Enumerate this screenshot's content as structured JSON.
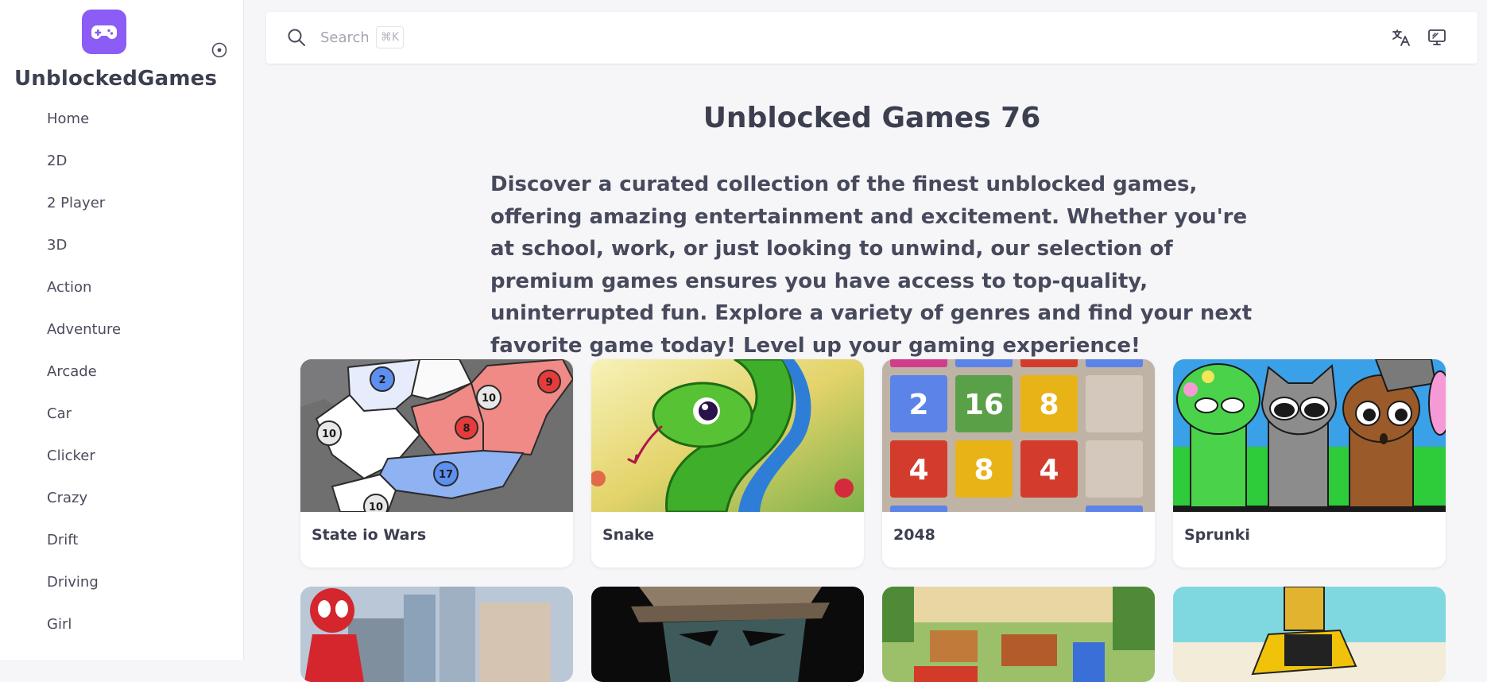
{
  "brand": {
    "name": "UnblockedGames",
    "logo_icon": "gamepad-icon",
    "accent": "#8b5cf6"
  },
  "sidebar": {
    "collapse_icon": "collapse-circle-icon",
    "items": [
      {
        "label": "Home"
      },
      {
        "label": "2D"
      },
      {
        "label": "2 Player"
      },
      {
        "label": "3D"
      },
      {
        "label": "Action"
      },
      {
        "label": "Adventure"
      },
      {
        "label": "Arcade"
      },
      {
        "label": "Car"
      },
      {
        "label": "Clicker"
      },
      {
        "label": "Crazy"
      },
      {
        "label": "Drift"
      },
      {
        "label": "Driving"
      },
      {
        "label": "Girl"
      }
    ]
  },
  "header": {
    "search": {
      "placeholder": "Search",
      "shortcut": "⌘K",
      "icon": "search-icon"
    },
    "icons": [
      "translate-icon",
      "monitor-icon"
    ]
  },
  "main": {
    "title": "Unblocked Games 76",
    "intro": "Discover a curated collection of the finest unblocked games, offering amazing entertainment and excitement. Whether you're at school, work, or just looking to unwind, our selection of premium games ensures you have access to top-quality, uninterrupted fun. Explore a variety of genres and find your next favorite game today! Level up your gaming experience!",
    "games": [
      {
        "name": "State io Wars",
        "numbers": [
          "2",
          "9",
          "10",
          "8",
          "10",
          "17",
          "10"
        ]
      },
      {
        "name": "Snake"
      },
      {
        "name": "2048",
        "tiles": [
          "2",
          "16",
          "8",
          "4",
          "8",
          "4"
        ]
      },
      {
        "name": "Sprunki"
      }
    ]
  }
}
